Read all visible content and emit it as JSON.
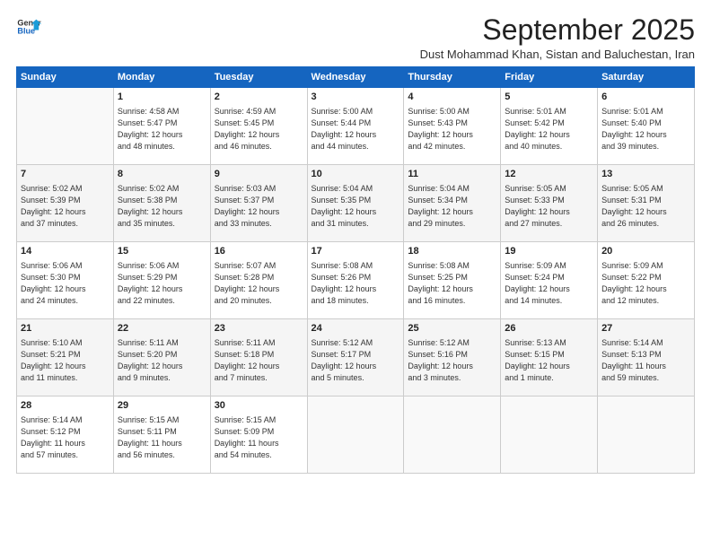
{
  "app": {
    "name_line1": "General",
    "name_line2": "Blue"
  },
  "header": {
    "month_title": "September 2025",
    "location": "Dust Mohammad Khan, Sistan and Baluchestan, Iran"
  },
  "weekdays": [
    "Sunday",
    "Monday",
    "Tuesday",
    "Wednesday",
    "Thursday",
    "Friday",
    "Saturday"
  ],
  "weeks": [
    [
      {
        "day": "",
        "info": ""
      },
      {
        "day": "1",
        "info": "Sunrise: 4:58 AM\nSunset: 5:47 PM\nDaylight: 12 hours\nand 48 minutes."
      },
      {
        "day": "2",
        "info": "Sunrise: 4:59 AM\nSunset: 5:45 PM\nDaylight: 12 hours\nand 46 minutes."
      },
      {
        "day": "3",
        "info": "Sunrise: 5:00 AM\nSunset: 5:44 PM\nDaylight: 12 hours\nand 44 minutes."
      },
      {
        "day": "4",
        "info": "Sunrise: 5:00 AM\nSunset: 5:43 PM\nDaylight: 12 hours\nand 42 minutes."
      },
      {
        "day": "5",
        "info": "Sunrise: 5:01 AM\nSunset: 5:42 PM\nDaylight: 12 hours\nand 40 minutes."
      },
      {
        "day": "6",
        "info": "Sunrise: 5:01 AM\nSunset: 5:40 PM\nDaylight: 12 hours\nand 39 minutes."
      }
    ],
    [
      {
        "day": "7",
        "info": "Sunrise: 5:02 AM\nSunset: 5:39 PM\nDaylight: 12 hours\nand 37 minutes."
      },
      {
        "day": "8",
        "info": "Sunrise: 5:02 AM\nSunset: 5:38 PM\nDaylight: 12 hours\nand 35 minutes."
      },
      {
        "day": "9",
        "info": "Sunrise: 5:03 AM\nSunset: 5:37 PM\nDaylight: 12 hours\nand 33 minutes."
      },
      {
        "day": "10",
        "info": "Sunrise: 5:04 AM\nSunset: 5:35 PM\nDaylight: 12 hours\nand 31 minutes."
      },
      {
        "day": "11",
        "info": "Sunrise: 5:04 AM\nSunset: 5:34 PM\nDaylight: 12 hours\nand 29 minutes."
      },
      {
        "day": "12",
        "info": "Sunrise: 5:05 AM\nSunset: 5:33 PM\nDaylight: 12 hours\nand 27 minutes."
      },
      {
        "day": "13",
        "info": "Sunrise: 5:05 AM\nSunset: 5:31 PM\nDaylight: 12 hours\nand 26 minutes."
      }
    ],
    [
      {
        "day": "14",
        "info": "Sunrise: 5:06 AM\nSunset: 5:30 PM\nDaylight: 12 hours\nand 24 minutes."
      },
      {
        "day": "15",
        "info": "Sunrise: 5:06 AM\nSunset: 5:29 PM\nDaylight: 12 hours\nand 22 minutes."
      },
      {
        "day": "16",
        "info": "Sunrise: 5:07 AM\nSunset: 5:28 PM\nDaylight: 12 hours\nand 20 minutes."
      },
      {
        "day": "17",
        "info": "Sunrise: 5:08 AM\nSunset: 5:26 PM\nDaylight: 12 hours\nand 18 minutes."
      },
      {
        "day": "18",
        "info": "Sunrise: 5:08 AM\nSunset: 5:25 PM\nDaylight: 12 hours\nand 16 minutes."
      },
      {
        "day": "19",
        "info": "Sunrise: 5:09 AM\nSunset: 5:24 PM\nDaylight: 12 hours\nand 14 minutes."
      },
      {
        "day": "20",
        "info": "Sunrise: 5:09 AM\nSunset: 5:22 PM\nDaylight: 12 hours\nand 12 minutes."
      }
    ],
    [
      {
        "day": "21",
        "info": "Sunrise: 5:10 AM\nSunset: 5:21 PM\nDaylight: 12 hours\nand 11 minutes."
      },
      {
        "day": "22",
        "info": "Sunrise: 5:11 AM\nSunset: 5:20 PM\nDaylight: 12 hours\nand 9 minutes."
      },
      {
        "day": "23",
        "info": "Sunrise: 5:11 AM\nSunset: 5:18 PM\nDaylight: 12 hours\nand 7 minutes."
      },
      {
        "day": "24",
        "info": "Sunrise: 5:12 AM\nSunset: 5:17 PM\nDaylight: 12 hours\nand 5 minutes."
      },
      {
        "day": "25",
        "info": "Sunrise: 5:12 AM\nSunset: 5:16 PM\nDaylight: 12 hours\nand 3 minutes."
      },
      {
        "day": "26",
        "info": "Sunrise: 5:13 AM\nSunset: 5:15 PM\nDaylight: 12 hours\nand 1 minute."
      },
      {
        "day": "27",
        "info": "Sunrise: 5:14 AM\nSunset: 5:13 PM\nDaylight: 11 hours\nand 59 minutes."
      }
    ],
    [
      {
        "day": "28",
        "info": "Sunrise: 5:14 AM\nSunset: 5:12 PM\nDaylight: 11 hours\nand 57 minutes."
      },
      {
        "day": "29",
        "info": "Sunrise: 5:15 AM\nSunset: 5:11 PM\nDaylight: 11 hours\nand 56 minutes."
      },
      {
        "day": "30",
        "info": "Sunrise: 5:15 AM\nSunset: 5:09 PM\nDaylight: 11 hours\nand 54 minutes."
      },
      {
        "day": "",
        "info": ""
      },
      {
        "day": "",
        "info": ""
      },
      {
        "day": "",
        "info": ""
      },
      {
        "day": "",
        "info": ""
      }
    ]
  ]
}
